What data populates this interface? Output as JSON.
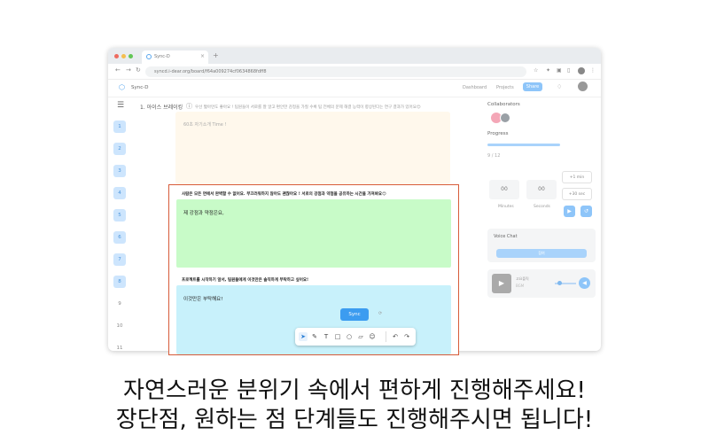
{
  "browser": {
    "tab_title": "Sync-D",
    "url": "syncd.i-dear.org/board/f64a009274cf0634868fdff8"
  },
  "app": {
    "brand": "Sync-D",
    "nav": [
      "Dashboard",
      "Projects"
    ],
    "share_label": "Share"
  },
  "sidebar": {
    "items": [
      "1",
      "2",
      "3",
      "4",
      "5",
      "6",
      "7",
      "8",
      "9",
      "10",
      "11"
    ]
  },
  "main": {
    "breadcrumb": "1. 아이스 브레이킹",
    "question": "우선 짧아먼도 좋아요 ! 팀원들이 서로를 잘 알고 편안한 감정을 가질 수록 팀 전체의 문제 해결 능력이 향상된다는 연구 결과가 있어요😊",
    "card_text": "60초 자기소개 Time !"
  },
  "right": {
    "collaborators_label": "Collaborators",
    "progress_label": "Progress",
    "progress_count": "9 / 12",
    "progress_value": 0.75,
    "minutes": "00",
    "seconds": "00",
    "minutes_label": "Minutes",
    "seconds_label": "Seconds",
    "plus_min": "+1 min",
    "plus_sec": "+30 sec",
    "voice_chat_label": "Voice Chat",
    "voice_button": "참여",
    "player_title": "고요플릭",
    "player_sub": "BGM",
    "volume_level": 0.25
  },
  "overlay": {
    "q1": "사람은 모든 면에서 완벽할 수 없어요. 부끄러워하지 않아도 괜찮아요 ! 서로의 강점과 약점을 공유하는 시간을 가져봐요😊",
    "a1": "제 강점과 약점은요,",
    "q2": "프로젝트를 시작하기 앞서, 팀원들에게 이것만은 솔직하게 부탁하고 싶어요!",
    "a2": "이것만은 부탁해요!",
    "sync_label": "Sync",
    "sync_hint": "⟳"
  },
  "captions": {
    "line1": "자연스러운 분위기 속에서 편하게 진행해주세요!",
    "line2": "장단점, 원하는 점 단계들도 진행해주시면 됩니다!"
  },
  "colors": {
    "accent": "#3c9cf0",
    "highlight_border": "#d75c3a",
    "green_card": "#c8fbc8",
    "cyan_card": "#c8f1fb",
    "yellow_card": "#fff8ec"
  },
  "icons": [
    "menu-icon",
    "info-icon",
    "pointer-icon",
    "pen-icon",
    "text-icon",
    "square-icon",
    "circle-icon",
    "sticky-note-icon",
    "emoji-icon",
    "undo-icon",
    "redo-icon",
    "bell-icon",
    "play-icon",
    "reset-icon",
    "volume-icon"
  ]
}
